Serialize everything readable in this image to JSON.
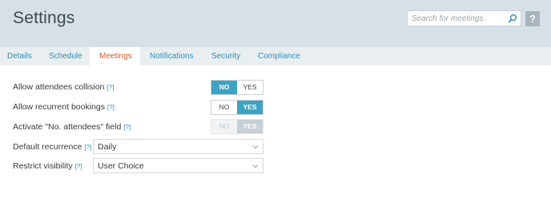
{
  "header": {
    "title": "Settings",
    "search_placeholder": "Search for meetings",
    "help_label": "?"
  },
  "tabs": [
    {
      "label": "Details",
      "active": false
    },
    {
      "label": "Schedule",
      "active": false
    },
    {
      "label": "Meetings",
      "active": true
    },
    {
      "label": "Notifications",
      "active": false
    },
    {
      "label": "Security",
      "active": false
    },
    {
      "label": "Compliance",
      "active": false
    }
  ],
  "settings": {
    "collision": {
      "label": "Allow attendees collision",
      "help": "[?]",
      "no": "NO",
      "yes": "YES",
      "value": "NO"
    },
    "recurrent": {
      "label": "Allow recurrent bookings",
      "help": "[?]",
      "no": "NO",
      "yes": "YES",
      "value": "YES"
    },
    "attendees_field": {
      "label": "Activate \"No. attendees\" field",
      "help": "[?]",
      "no": "NO",
      "yes": "YES",
      "value": "YES",
      "disabled": true
    },
    "default_recurrence": {
      "label": "Default recurrence",
      "help": "[?]",
      "value": "Daily"
    },
    "restrict_visibility": {
      "label": "Restrict visibility",
      "help": "[?]",
      "value": "User Choice"
    }
  },
  "colors": {
    "accent": "#3ea3c2",
    "active_tab_text": "#e05528",
    "link": "#2b8fb5",
    "header_bg": "#d7e0e6"
  },
  "icons": {
    "search": "search-icon",
    "chevron": "chevron-down-icon"
  }
}
